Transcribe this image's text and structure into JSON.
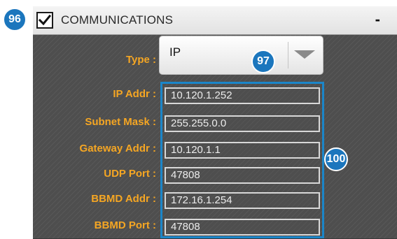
{
  "callouts": {
    "header": "96",
    "type_dropdown": "97",
    "fields_group": "100"
  },
  "header": {
    "title": "COMMUNICATIONS",
    "checked": true,
    "collapse_label": "-"
  },
  "type": {
    "label": "Type :",
    "value": "IP"
  },
  "fields": [
    {
      "label": "IP Addr :",
      "value": "10.120.1.252"
    },
    {
      "label": "Subnet Mask :",
      "value": "255.255.0.0"
    },
    {
      "label": "Gateway Addr :",
      "value": "10.120.1.1"
    },
    {
      "label": "UDP Port :",
      "value": "47808"
    },
    {
      "label": "BBMD Addr :",
      "value": "172.16.1.254"
    },
    {
      "label": "BBMD Port :",
      "value": "47808"
    }
  ],
  "colors": {
    "label_accent": "#f5a623",
    "callout_blue": "#1b76bd",
    "highlight_border": "#1b86c9",
    "panel_background": "#4e4e4e"
  },
  "icons": {
    "checkbox": "checkmark-icon",
    "dropdown": "triangle-down-icon"
  }
}
